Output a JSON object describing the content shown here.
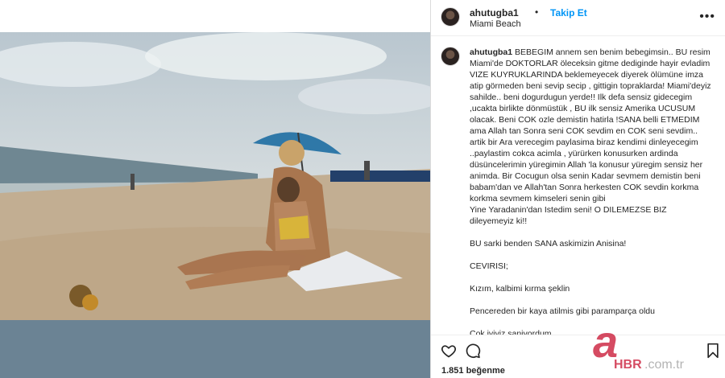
{
  "post": {
    "username": "ahutugba1",
    "separator": "•",
    "follow_label": "Takip Et",
    "location": "Miami Beach",
    "more_icon": "more-horizontal-icon"
  },
  "caption": {
    "username": "ahutugba1",
    "text": " BEBEGIM annem sen benim bebegimsin.. BU resim Miami'de DOKTORLAR öleceksin gitme dediginde hayir evladim VIZE KUYRUKLARINDA beklemeyecek diyerek ölümüne imza atip görmeden beni sevip secip , gittigin topraklarda! Miami'deyiz sahilde.. beni dogurdugun yerde!! Ilk defa sensiz gidecegim ,ucakta birlikte dönmüstük , BU ilk sensiz Amerika UCUSUM olacak. Beni COK ozle demistin hatirla !SANA belli ETMEDIM ama Allah tan Sonra seni COK sevdim en COK seni sevdim.. artik bir Ara verecegim paylasima biraz kendimi dinleyecegim ..paylastim cokca acimla , yürürken konusurken ardinda düsüncelerimin yüregimin Allah 'la konusur yüregim sensiz her animda. Bir Cocugun olsa senin Kadar sevmem demistin beni babam'dan ve Allah'tan Sonra herkesten COK sevdin korkma korkma sevmem kimseleri senin gibi\nYine Yaradanin'dan Istedim seni! O DILEMEZSE BIZ dileyemeyiz ki!!\n\nBU sarki benden SANA askimizin Anisina!\n\nCEVIRISI;\n\nKızım, kalbimi kırma şeklin\n\nPencereden bir kaya atilmis gibi paramparça oldu\n\nCok iyiyiz saniyordum"
  },
  "actions": {
    "like_icon": "heart-icon",
    "comment_icon": "comment-icon",
    "save_icon": "bookmark-icon"
  },
  "likes": "1.851 beğenme",
  "watermark": {
    "letter": "a",
    "brand": "HBR",
    "domain": ".com.tr"
  },
  "colors": {
    "accent": "#0095f6",
    "text": "#262626",
    "watermark": "#c8102e"
  }
}
